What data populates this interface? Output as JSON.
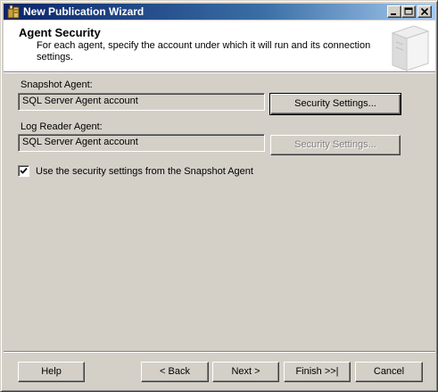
{
  "window": {
    "title": "New Publication Wizard"
  },
  "header": {
    "title": "Agent Security",
    "subtitle": "For each agent, specify the account under which it will run and its connection settings."
  },
  "snapshot_agent": {
    "label": "Snapshot Agent:",
    "value": "SQL Server Agent account",
    "button_label": "Security Settings..."
  },
  "log_reader_agent": {
    "label": "Log Reader Agent:",
    "value": "SQL Server Agent account",
    "button_label": "Security Settings..."
  },
  "use_snapshot_settings": {
    "label": "Use the security settings from the Snapshot Agent",
    "checked": true
  },
  "footer": {
    "help_label": "Help",
    "back_label": "< Back",
    "next_label": "Next >",
    "finish_label": "Finish >>|",
    "cancel_label": "Cancel"
  },
  "icons": {
    "app": "wizard-app-icon",
    "header": "server-graphic-icon",
    "minimize": "minimize-icon",
    "maximize": "maximize-icon",
    "close": "close-icon",
    "check": "checkmark-icon"
  },
  "colors": {
    "titlebar_start": "#0a246a",
    "titlebar_end": "#a6caf0",
    "face": "#d4d0c8",
    "disabled_text": "#808080"
  }
}
